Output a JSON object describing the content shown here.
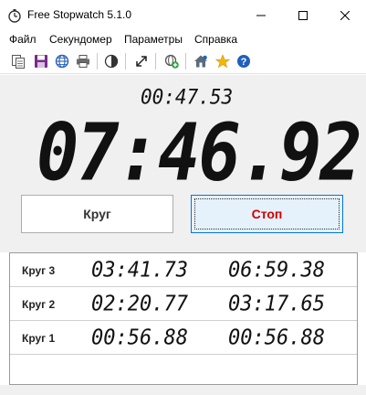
{
  "window": {
    "title": "Free Stopwatch 5.1.0"
  },
  "menu": {
    "items": [
      "Файл",
      "Секундомер",
      "Параметры",
      "Справка"
    ]
  },
  "toolbar": {
    "icons": [
      "copy-icon",
      "save-icon",
      "globe-icon",
      "print-icon",
      "contrast-icon",
      "fullscreen-icon",
      "add-web-icon",
      "home-icon",
      "star-icon",
      "help-icon"
    ],
    "colors": {
      "save": "#7a2a8c",
      "globe": "#2a62b8",
      "star": "#f2b705",
      "help": "#1f5fbf"
    }
  },
  "display": {
    "lap_time": "00:47.53",
    "total_time": "07:46.92"
  },
  "buttons": {
    "lap_label": "Круг",
    "stop_label": "Стоп",
    "stop_color": "#d00000"
  },
  "laps": [
    {
      "name": "Круг 3",
      "split": "03:41.73",
      "total": "06:59.38"
    },
    {
      "name": "Круг 2",
      "split": "02:20.77",
      "total": "03:17.65"
    },
    {
      "name": "Круг 1",
      "split": "00:56.88",
      "total": "00:56.88"
    }
  ]
}
